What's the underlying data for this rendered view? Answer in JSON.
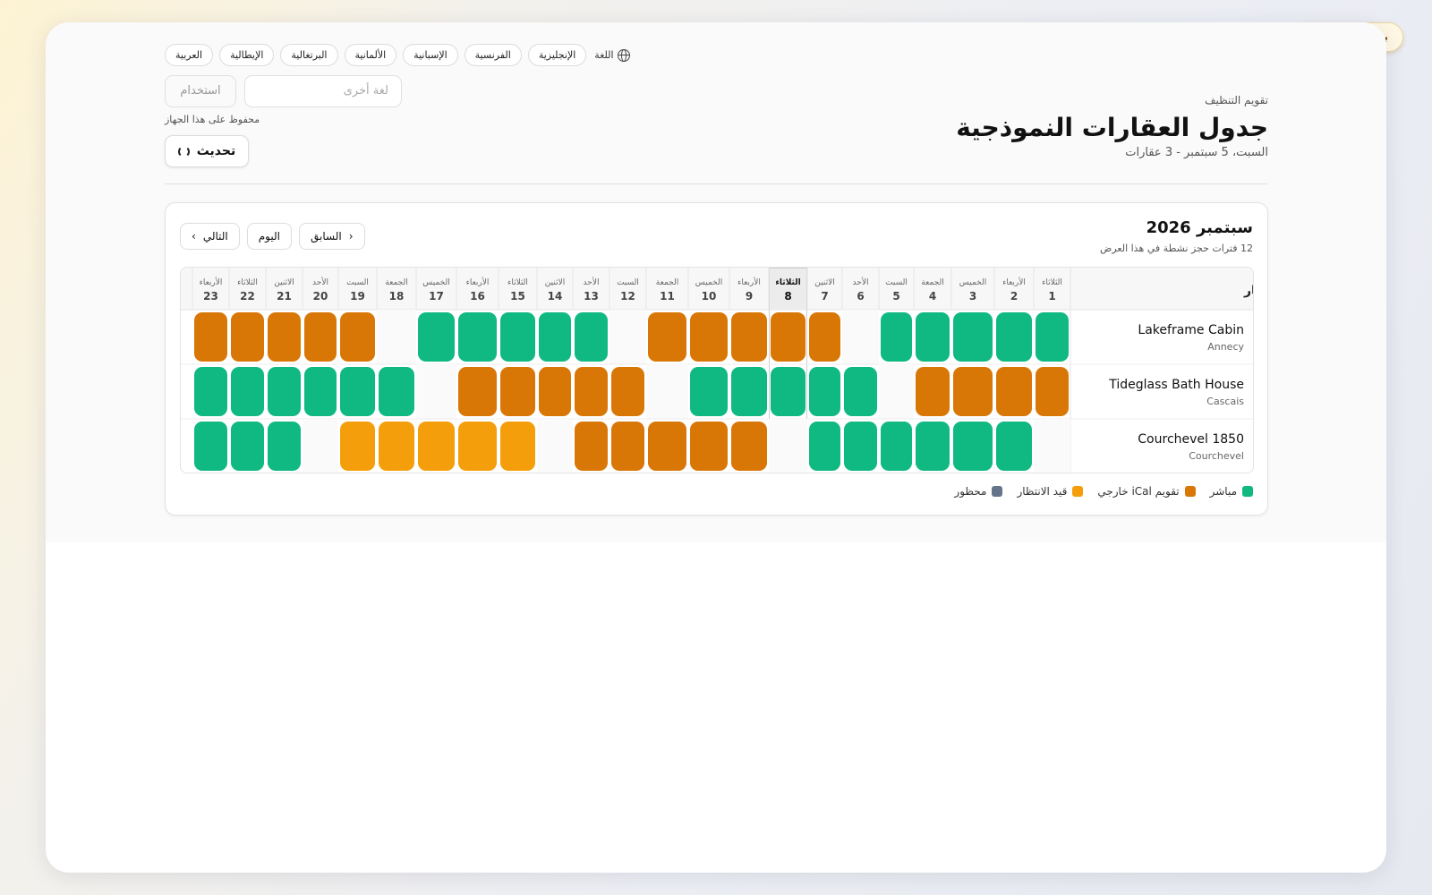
{
  "demo_badge": "بيانات توضيحية",
  "language": {
    "label": "اللغة",
    "options": [
      "الإنجليزية",
      "الفرنسية",
      "الإسبانية",
      "الألمانية",
      "البرتغالية",
      "الإيطالية",
      "العربية"
    ],
    "active": "العربية",
    "other_placeholder": "لغة أخرى",
    "use_label": "استخدام",
    "saved_note": "محفوظ على هذا الجهاز"
  },
  "refresh_label": "تحديث",
  "header": {
    "eyebrow": "تقويم التنظيف",
    "title": "جدول العقارات النموذجية",
    "subtitle": "السبت، 5 سبتمبر - 3 عقارات"
  },
  "calendar": {
    "month_title": "سبتمبر 2026",
    "summary": "12 فترات حجز نشطة في هذا العرض",
    "nav": {
      "prev": "السابق",
      "today": "اليوم",
      "next": "التالي"
    },
    "property_header": "العقار",
    "today_index": 7,
    "days": [
      {
        "dow": "الثلاثاء",
        "num": "1"
      },
      {
        "dow": "الأربعاء",
        "num": "2"
      },
      {
        "dow": "الخميس",
        "num": "3"
      },
      {
        "dow": "الجمعة",
        "num": "4"
      },
      {
        "dow": "السبت",
        "num": "5"
      },
      {
        "dow": "الأحد",
        "num": "6"
      },
      {
        "dow": "الاثنين",
        "num": "7"
      },
      {
        "dow": "الثلاثاء",
        "num": "8"
      },
      {
        "dow": "الأربعاء",
        "num": "9"
      },
      {
        "dow": "الخميس",
        "num": "10"
      },
      {
        "dow": "الجمعة",
        "num": "11"
      },
      {
        "dow": "السبت",
        "num": "12"
      },
      {
        "dow": "الأحد",
        "num": "13"
      },
      {
        "dow": "الاثنين",
        "num": "14"
      },
      {
        "dow": "الثلاثاء",
        "num": "15"
      },
      {
        "dow": "الأربعاء",
        "num": "16"
      },
      {
        "dow": "الخميس",
        "num": "17"
      },
      {
        "dow": "الجمعة",
        "num": "18"
      },
      {
        "dow": "السبت",
        "num": "19"
      },
      {
        "dow": "الأحد",
        "num": "20"
      },
      {
        "dow": "الاثنين",
        "num": "21"
      },
      {
        "dow": "الثلاثاء",
        "num": "22"
      },
      {
        "dow": "الأربعاء",
        "num": "23"
      }
    ],
    "properties": [
      {
        "name": "Lakeframe Cabin",
        "location": "Annecy",
        "cells": [
          "L",
          "L",
          "L",
          "L",
          "L",
          "",
          "I",
          "I",
          "I",
          "I",
          "I",
          "",
          "L",
          "L",
          "L",
          "L",
          "L",
          "",
          "I",
          "I",
          "I",
          "I",
          "I"
        ]
      },
      {
        "name": "Tideglass Bath House",
        "location": "Cascais",
        "cells": [
          "I",
          "I",
          "I",
          "I",
          "",
          "L",
          "L",
          "L",
          "L",
          "L",
          "",
          "I",
          "I",
          "I",
          "I",
          "I",
          "",
          "L",
          "L",
          "L",
          "L",
          "L",
          "L"
        ]
      },
      {
        "name": "Courchevel 1850",
        "location": "Courchevel",
        "cells": [
          "",
          "L",
          "L",
          "L",
          "L",
          "L",
          "L",
          "",
          "I",
          "I",
          "I",
          "I",
          "I",
          "",
          "P",
          "P",
          "P",
          "P",
          "P",
          "",
          "L",
          "L",
          "L"
        ]
      }
    ],
    "status_colors": {
      "L": "#10b981",
      "I": "#d97706",
      "P": "#f59e0b",
      "B": "#64748b"
    },
    "legend": [
      {
        "key": "L",
        "label": "مباشر",
        "color": "#10b981"
      },
      {
        "key": "I",
        "label": "تقويم iCal خارجي",
        "color": "#d97706"
      },
      {
        "key": "P",
        "label": "قيد الانتظار",
        "color": "#f59e0b"
      },
      {
        "key": "B",
        "label": "محظور",
        "color": "#64748b"
      }
    ]
  }
}
